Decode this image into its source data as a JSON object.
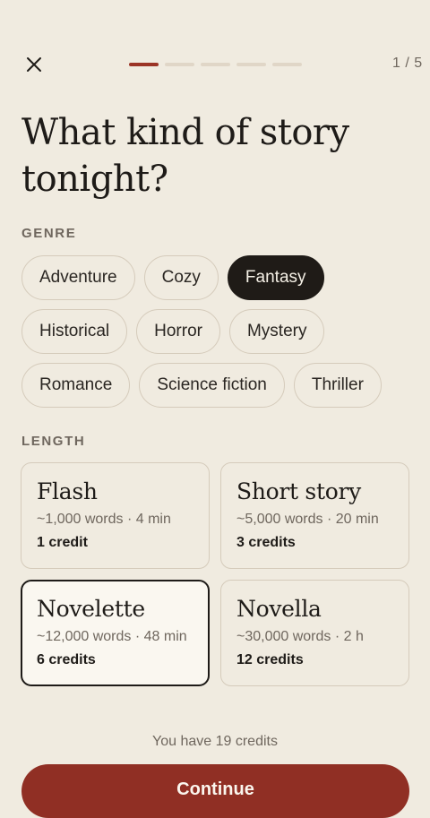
{
  "header": {
    "close_icon": "close-icon",
    "progress": {
      "total_steps": 5,
      "current_step": 1
    },
    "step_text": "1 / 5"
  },
  "title": "What kind of story tonight?",
  "genre": {
    "label": "GENRE",
    "rows": [
      [
        {
          "label": "Adventure",
          "selected": false
        },
        {
          "label": "Cozy",
          "selected": false
        },
        {
          "label": "Fantasy",
          "selected": true
        }
      ],
      [
        {
          "label": "Historical",
          "selected": false
        },
        {
          "label": "Horror",
          "selected": false
        },
        {
          "label": "Mystery",
          "selected": false
        }
      ],
      [
        {
          "label": "Romance",
          "selected": false
        },
        {
          "label": "Science fiction",
          "selected": false
        },
        {
          "label": "Thriller",
          "selected": false
        }
      ]
    ]
  },
  "length": {
    "label": "LENGTH",
    "options": [
      {
        "name": "Flash",
        "meta": "~1,000 words · 4 min",
        "credits": "1 credit",
        "selected": false
      },
      {
        "name": "Short story",
        "meta": "~5,000 words · 20 min",
        "credits": "3 credits",
        "selected": false
      },
      {
        "name": "Novelette",
        "meta": "~12,000 words · 48 min",
        "credits": "6 credits",
        "selected": true
      },
      {
        "name": "Novella",
        "meta": "~30,000 words · 2 h",
        "credits": "12 credits",
        "selected": false
      }
    ]
  },
  "balance_text": "You have 19 credits",
  "continue_label": "Continue",
  "colors": {
    "accent": "#902f24",
    "background": "#f0ebe0",
    "selected_chip": "#1f1b17"
  }
}
